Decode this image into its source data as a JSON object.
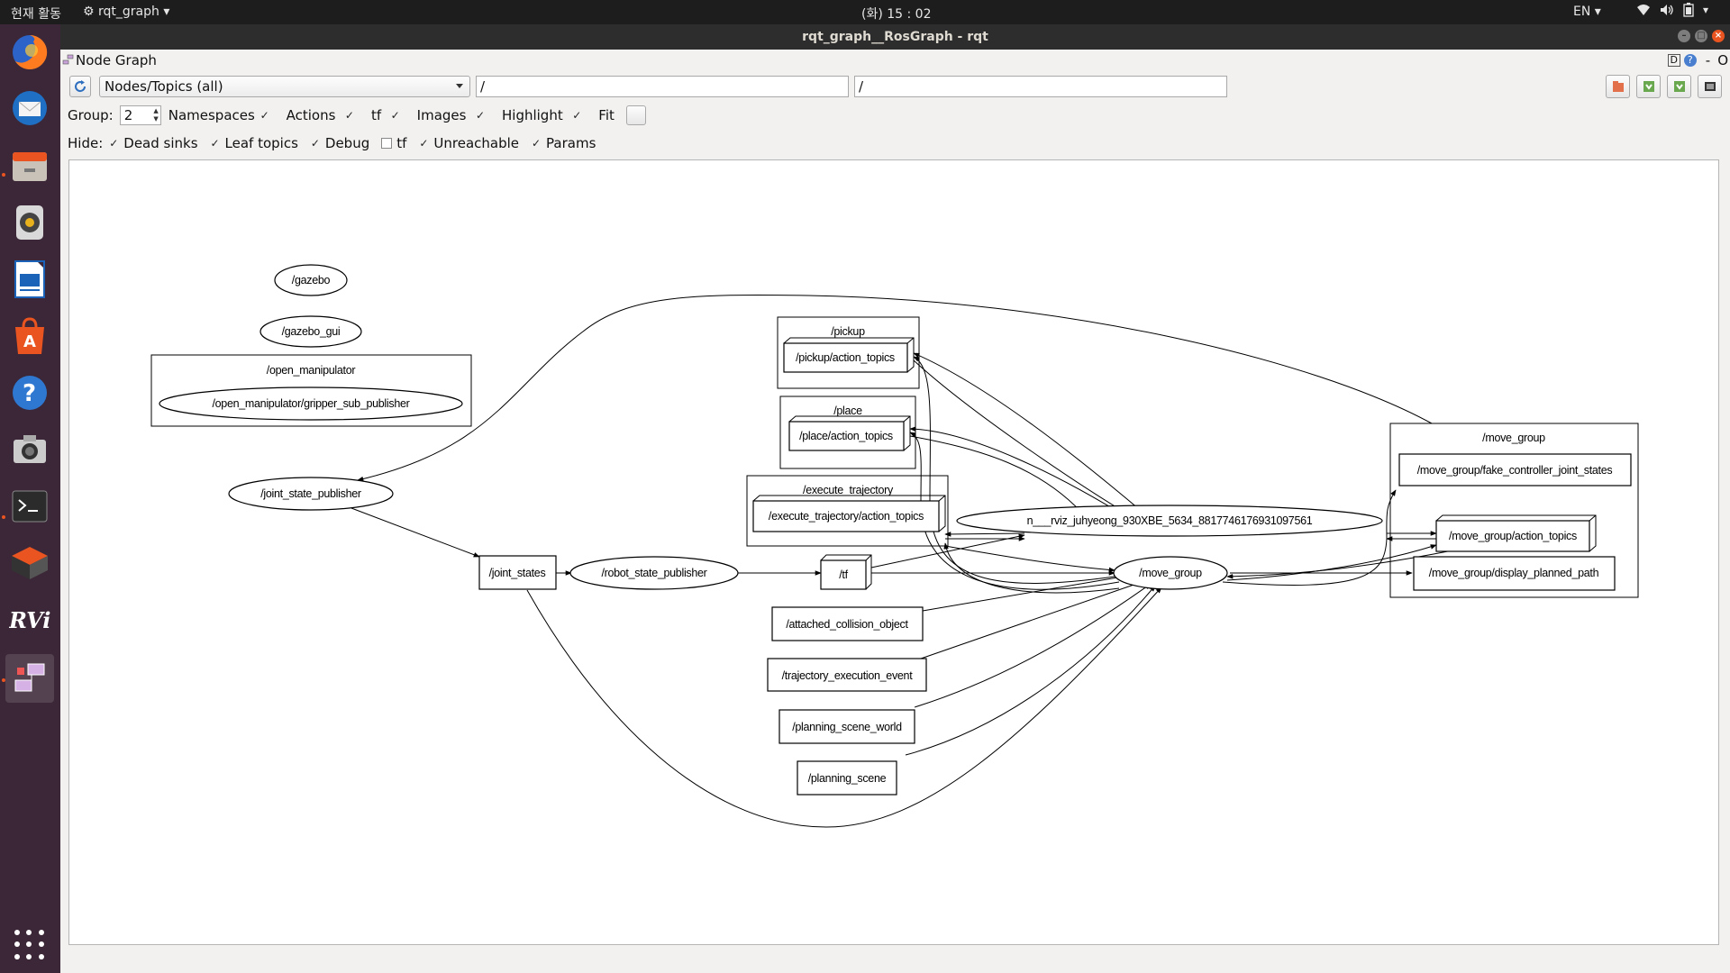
{
  "topbar": {
    "activities": "현재 활동",
    "app_menu": "rqt_graph",
    "clock": "(화) 15 : 02",
    "language": "EN"
  },
  "dock": {
    "items": [
      "firefox-icon",
      "thunderbird-icon",
      "files-icon",
      "rhythmbox-icon",
      "writer-icon",
      "software-icon",
      "help-icon",
      "camera-icon",
      "terminal-icon",
      "installer-icon",
      "rviz-icon",
      "rqt-icon"
    ]
  },
  "window": {
    "title": "rqt_graph__RosGraph - rqt",
    "plugin_title": "Node Graph",
    "plugin_controls": [
      "D",
      "?",
      "-",
      "O"
    ]
  },
  "toolbar": {
    "combo_value": "Nodes/Topics (all)",
    "filter1": "/",
    "filter2": "/"
  },
  "options": {
    "group_label": "Group:",
    "group_value": "2",
    "namespaces": "Namespaces",
    "actions": "Actions",
    "tf": "tf",
    "images": "Images",
    "highlight": "Highlight",
    "fit": "Fit"
  },
  "hide": {
    "label": "Hide:",
    "dead_sinks": "Dead sinks",
    "leaf_topics": "Leaf topics",
    "debug": "Debug",
    "tf": "tf",
    "unreachable": "Unreachable",
    "params": "Params"
  },
  "graph": {
    "clusters": [
      {
        "id": "c-open-manipulator",
        "label": "/open_manipulator"
      },
      {
        "id": "c-pickup",
        "label": "/pickup"
      },
      {
        "id": "c-place",
        "label": "/place"
      },
      {
        "id": "c-execute",
        "label": "/execute_trajectory"
      },
      {
        "id": "c-move-group",
        "label": "/move_group"
      }
    ],
    "nodes": [
      {
        "id": "gazebo",
        "label": "/gazebo",
        "shape": "ellipse"
      },
      {
        "id": "gazebo_gui",
        "label": "/gazebo_gui",
        "shape": "ellipse"
      },
      {
        "id": "gripper_sub_publisher",
        "label": "/open_manipulator/gripper_sub_publisher",
        "shape": "ellipse"
      },
      {
        "id": "joint_state_publisher",
        "label": "/joint_state_publisher",
        "shape": "ellipse"
      },
      {
        "id": "joint_states",
        "label": "/joint_states",
        "shape": "box"
      },
      {
        "id": "robot_state_publisher",
        "label": "/robot_state_publisher",
        "shape": "ellipse"
      },
      {
        "id": "tf",
        "label": "/tf",
        "shape": "box3d"
      },
      {
        "id": "pickup_action",
        "label": "/pickup/action_topics",
        "shape": "box3d"
      },
      {
        "id": "place_action",
        "label": "/place/action_topics",
        "shape": "box3d"
      },
      {
        "id": "exec_action",
        "label": "/execute_trajectory/action_topics",
        "shape": "box3d"
      },
      {
        "id": "rviz",
        "label": "n___rviz_juhyeong_930XBE_5634_8817746176931097561",
        "shape": "ellipse"
      },
      {
        "id": "move_group",
        "label": "/move_group",
        "shape": "ellipse"
      },
      {
        "id": "attached",
        "label": "/attached_collision_object",
        "shape": "box"
      },
      {
        "id": "traj_event",
        "label": "/trajectory_execution_event",
        "shape": "box"
      },
      {
        "id": "ps_world",
        "label": "/planning_scene_world",
        "shape": "box"
      },
      {
        "id": "ps",
        "label": "/planning_scene",
        "shape": "box"
      },
      {
        "id": "fake_ctrl",
        "label": "/move_group/fake_controller_joint_states",
        "shape": "box"
      },
      {
        "id": "mg_action",
        "label": "/move_group/action_topics",
        "shape": "box3d"
      },
      {
        "id": "display_path",
        "label": "/move_group/display_planned_path",
        "shape": "box"
      }
    ]
  }
}
